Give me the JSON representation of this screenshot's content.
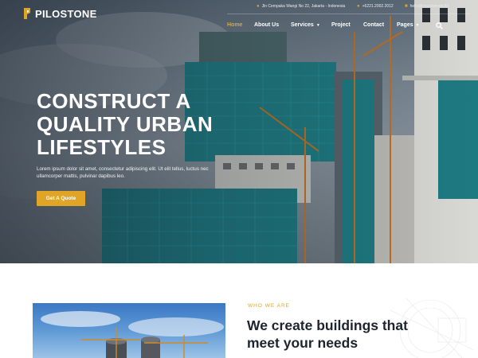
{
  "brand": {
    "name": "PILOSTONE",
    "accent": "#e0a526"
  },
  "topbar": {
    "address": "Jln Cempaka Wangi No 22, Jakarta - Indonesia",
    "phone": "+6221.2002.2012",
    "email": "hello@yourdomain.tld"
  },
  "nav": {
    "items": [
      {
        "label": "Home",
        "active": true
      },
      {
        "label": "About Us"
      },
      {
        "label": "Services",
        "dropdown": true
      },
      {
        "label": "Project"
      },
      {
        "label": "Contact"
      },
      {
        "label": "Pages",
        "dropdown": true
      }
    ],
    "search_icon": "search-icon"
  },
  "hero": {
    "title": "CONSTRUCT A QUALITY URBAN LIFESTYLES",
    "text": "Lorem ipsum dolor sit amet, consectetur adipiscing elit. Ut elit tellus, luctus nec ullamcorper mattis, pulvinar dapibus leo.",
    "cta_label": "Get A Quote"
  },
  "about": {
    "eyebrow": "WHO WE ARE",
    "title": "We create buildings that meet your needs"
  }
}
